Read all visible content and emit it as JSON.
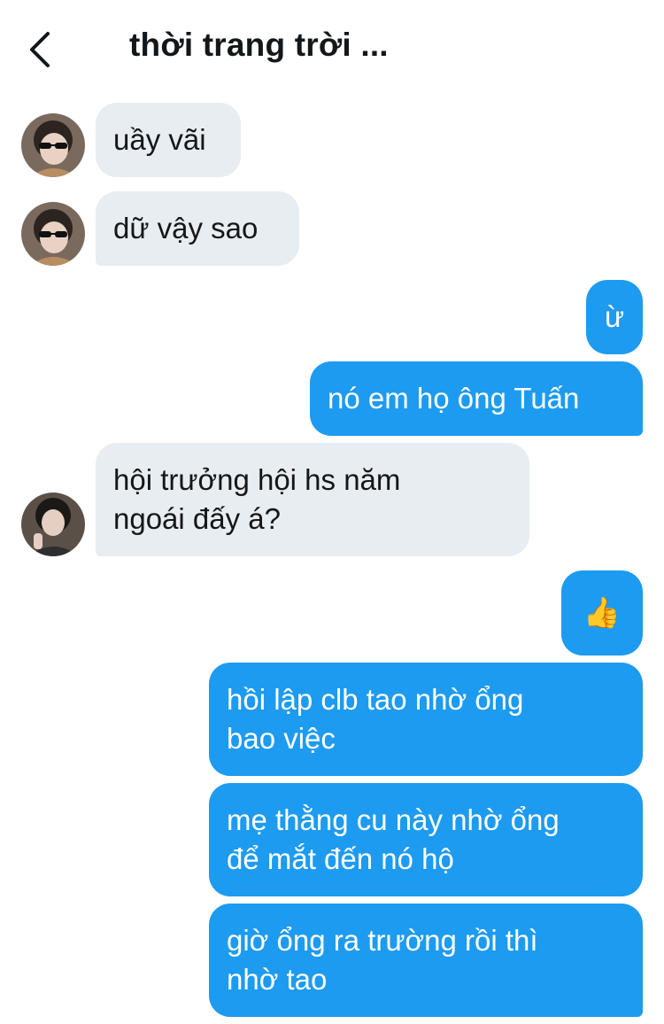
{
  "header": {
    "title": "thời trang trời ...",
    "back_icon": "chevron-left-icon"
  },
  "colors": {
    "outgoing_bubble": "#1d9bf0",
    "incoming_bubble": "#e8edf1",
    "text": "#14171a"
  },
  "messages": [
    {
      "direction": "incoming",
      "text": "uầy vãi"
    },
    {
      "direction": "incoming",
      "text": "dữ vậy sao"
    },
    {
      "direction": "outgoing",
      "text": "ừ"
    },
    {
      "direction": "outgoing",
      "text": "nó em họ ông Tuấn"
    },
    {
      "direction": "incoming",
      "lines": [
        "hội trưởng hội hs năm",
        "ngoái đấy á?"
      ]
    },
    {
      "direction": "outgoing",
      "text": "👍"
    },
    {
      "direction": "outgoing",
      "lines": [
        "hồi lập clb tao nhờ ổng",
        "bao việc"
      ]
    },
    {
      "direction": "outgoing",
      "lines": [
        "mẹ thằng cu này nhờ ổng",
        "để mắt đến nó hộ"
      ]
    },
    {
      "direction": "outgoing",
      "lines": [
        "giờ ổng ra trường rồi thì",
        "nhờ tao"
      ]
    }
  ]
}
